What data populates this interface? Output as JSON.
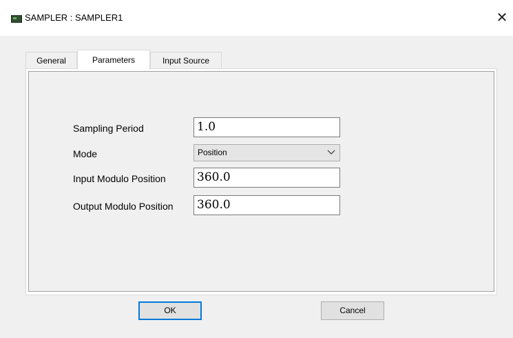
{
  "window": {
    "title": "SAMPLER : SAMPLER1",
    "close_glyph": "✕"
  },
  "tabs": [
    {
      "label": "General",
      "active": false
    },
    {
      "label": "Parameters",
      "active": true
    },
    {
      "label": "Input Source",
      "active": false
    }
  ],
  "params": {
    "sampling_period": {
      "label": "Sampling Period",
      "value": "1.0"
    },
    "mode": {
      "label": "Mode",
      "selected": "Position"
    },
    "input_modulo": {
      "label": "Input Modulo Position",
      "value": "360.0"
    },
    "output_modulo": {
      "label": "Output Modulo Position",
      "value": "360.0"
    }
  },
  "buttons": {
    "ok": "OK",
    "cancel": "Cancel"
  },
  "colors": {
    "accent": "#0078d7"
  }
}
